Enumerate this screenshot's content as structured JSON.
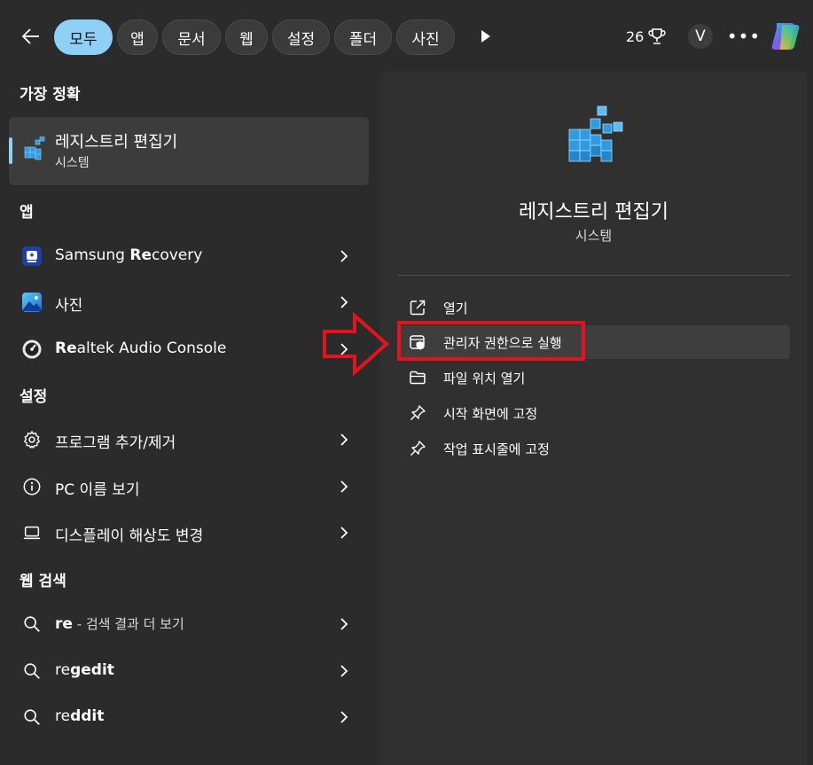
{
  "topbar": {
    "tabs": [
      "모두",
      "앱",
      "문서",
      "웹",
      "설정",
      "폴더",
      "사진"
    ],
    "points": "26",
    "avatar_letter": "V",
    "more": "•••"
  },
  "best_match": {
    "section": "가장 정확",
    "title": "레지스트리 편집기",
    "subtitle": "시스템"
  },
  "apps": {
    "section": "앱",
    "items": [
      {
        "prefix": "Samsung ",
        "bold": "Re",
        "suffix": "covery"
      },
      {
        "prefix": "",
        "bold": "",
        "suffix": "사진"
      },
      {
        "prefix": "",
        "bold": "Re",
        "suffix": "altek Audio Console"
      }
    ]
  },
  "settings": {
    "section": "설정",
    "items": [
      "프로그램 추가/제거",
      "PC 이름 보기",
      "디스플레이 해상도 변경"
    ]
  },
  "web": {
    "section": "웹 검색",
    "items": [
      {
        "bold": "re",
        "suffix": " - 검색 결과 더 보기"
      },
      {
        "bold": "re",
        "suffix": "gedit"
      },
      {
        "bold": "re",
        "suffix": "ddit"
      }
    ]
  },
  "detail": {
    "title": "레지스트리 편집기",
    "subtitle": "시스템",
    "actions": [
      "열기",
      "관리자 권한으로 실행",
      "파일 위치 열기",
      "시작 화면에 고정",
      "작업 표시줄에 고정"
    ]
  },
  "colors": {
    "accent": "#8fd0f7",
    "highlight_red": "#e3141e",
    "background": "#2b2b2b",
    "panel": "#303030"
  }
}
